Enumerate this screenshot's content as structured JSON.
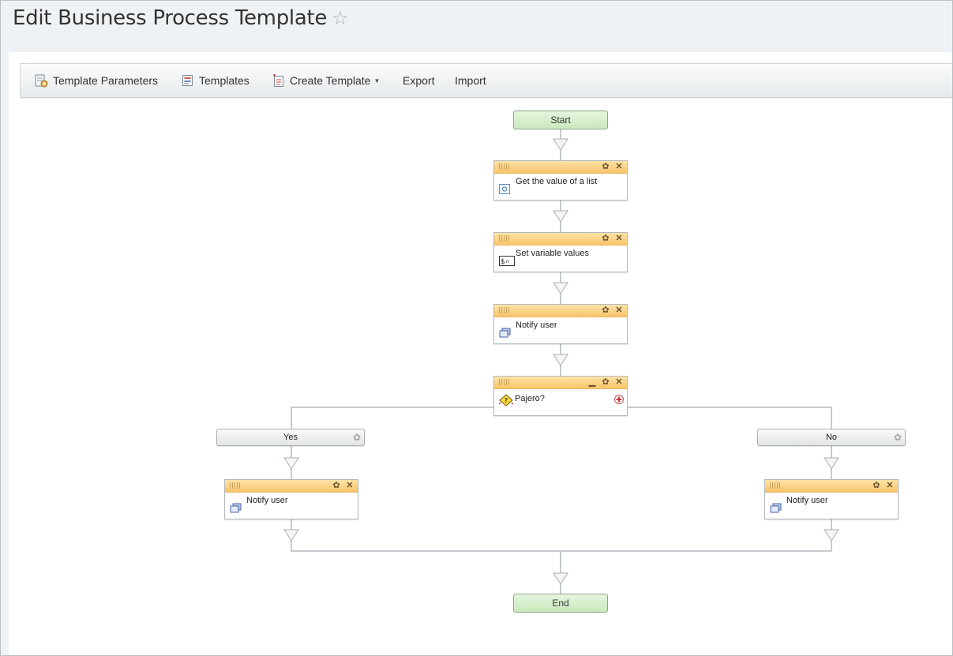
{
  "page": {
    "title": "Edit Business Process Template",
    "star_icon": "star-outline-icon"
  },
  "toolbar": {
    "items": [
      {
        "label": "Template Parameters",
        "icon": "template-parameters-icon"
      },
      {
        "label": "Templates",
        "icon": "templates-list-icon"
      },
      {
        "label": "Create Template",
        "icon": "create-template-icon",
        "has_dropdown": true
      },
      {
        "label": "Export"
      },
      {
        "label": "Import"
      }
    ]
  },
  "flow": {
    "start": "Start",
    "end": "End",
    "activities": {
      "get_list_value": "Get the value of a list",
      "set_variables": "Set variable values",
      "notify_user_1": "Notify user",
      "condition": "Pajero?",
      "notify_yes": "Notify user",
      "notify_no": "Notify user"
    },
    "branches": {
      "yes": "Yes",
      "no": "No"
    }
  },
  "colors": {
    "activity_header": "#f8c46a",
    "terminal_fill": "#d3eec8",
    "connector": "#c6cbcf"
  }
}
